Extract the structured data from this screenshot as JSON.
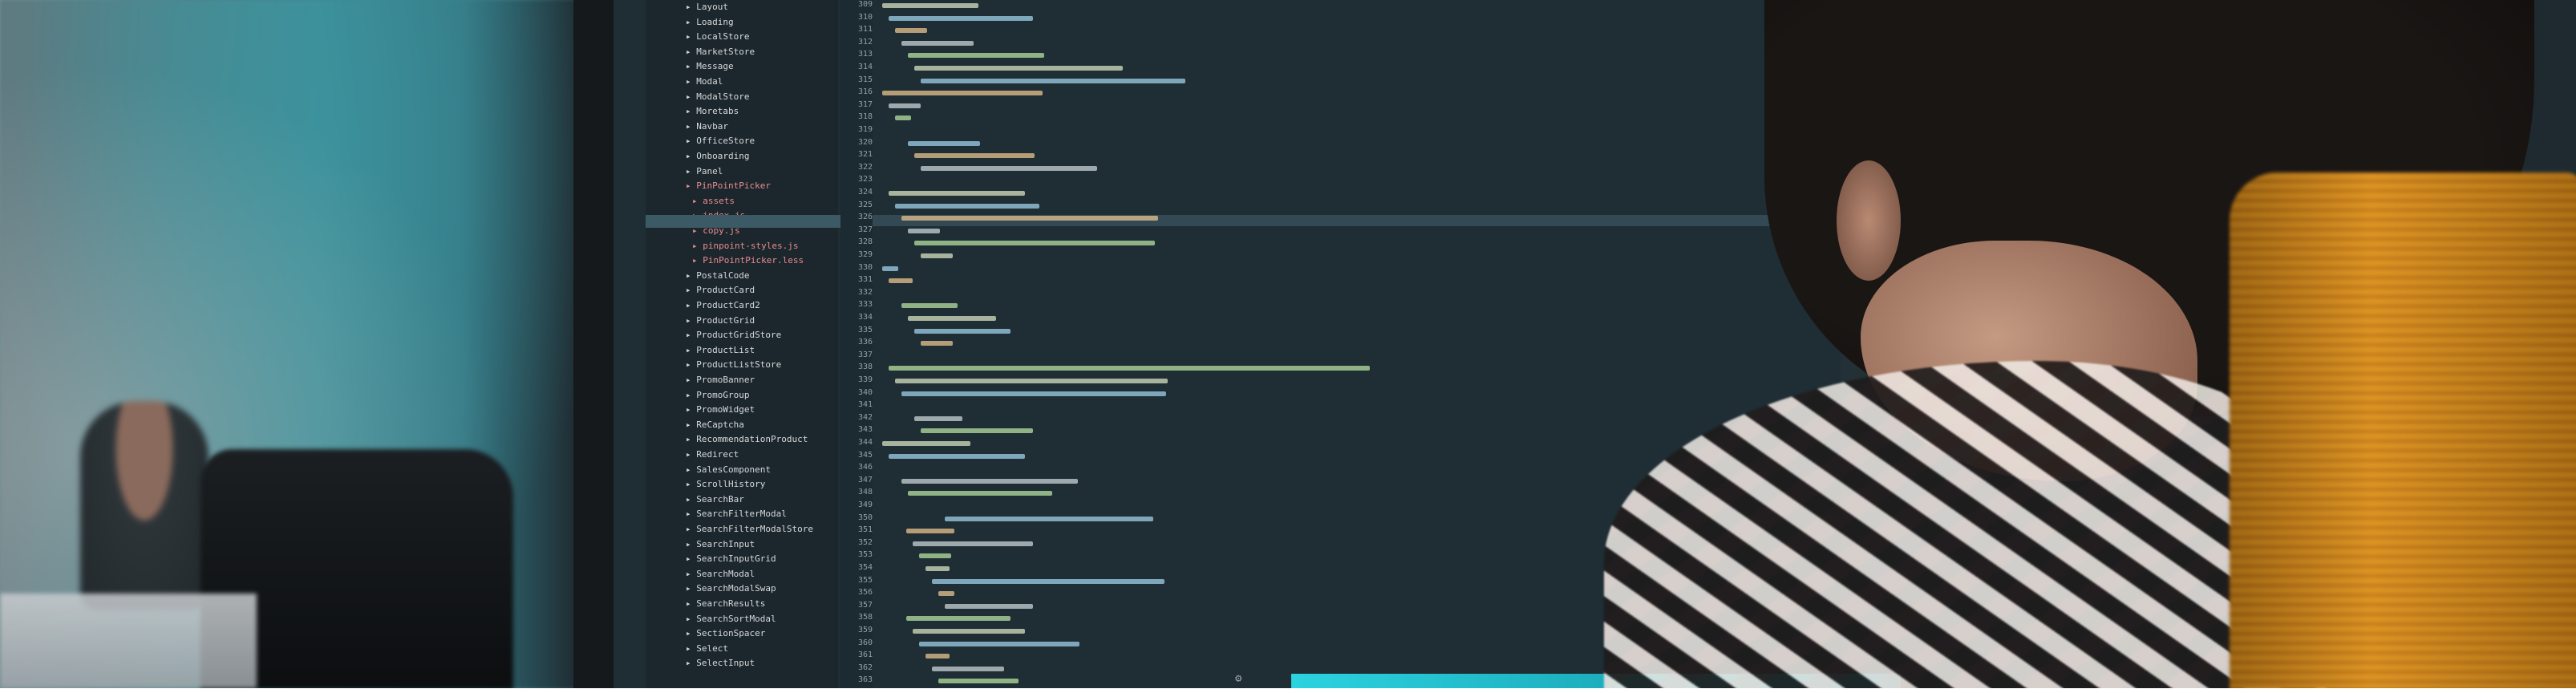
{
  "photo": {
    "description_icon": "photo",
    "tree_items": [
      "Layout",
      "Loading",
      "LocalStore",
      "MarketStore",
      "Message",
      "Modal",
      "ModalStore",
      "Moretabs",
      "Navbar",
      "OfficeStore",
      "Onboarding",
      "Panel",
      "PinPointPicker",
      "assets",
      "index.js",
      "copy.js",
      "pinpoint-styles.js",
      "PinPointPicker.less",
      "PostalCode",
      "ProductCard",
      "ProductCard2",
      "ProductGrid",
      "ProductGridStore",
      "ProductList",
      "ProductListStore",
      "PromoBanner",
      "PromoGroup",
      "PromoWidget",
      "ReCaptcha",
      "RecommendationProduct",
      "Redirect",
      "SalesComponent",
      "ScrollHistory",
      "SearchBar",
      "SearchFilterModal",
      "SearchFilterModalStore",
      "SearchInput",
      "SearchInputGrid",
      "SearchModal",
      "SearchModalSwap",
      "SearchResults",
      "SearchSortModal",
      "SectionSpacer",
      "Select",
      "SelectInput"
    ],
    "line_numbers": [
      "309",
      "310",
      "311",
      "312",
      "313",
      "314",
      "315",
      "316",
      "317",
      "318",
      "319",
      "320",
      "321",
      "322",
      "323",
      "324",
      "325",
      "326",
      "327",
      "328",
      "329",
      "330",
      "331",
      "332",
      "333",
      "334",
      "335",
      "336",
      "337",
      "338",
      "339",
      "340",
      "341",
      "342",
      "343",
      "344",
      "345",
      "346",
      "347",
      "348",
      "349",
      "350",
      "351",
      "352",
      "353",
      "354",
      "355",
      "356",
      "357",
      "358",
      "359",
      "360",
      "361",
      "362",
      "363"
    ]
  }
}
